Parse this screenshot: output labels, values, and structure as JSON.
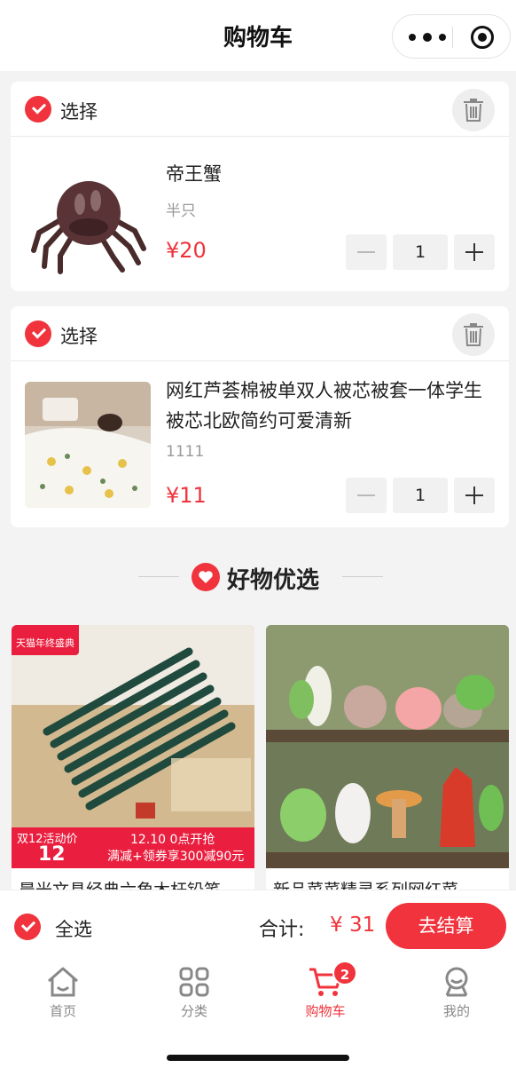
{
  "header": {
    "title": "购物车"
  },
  "cart": {
    "items": [
      {
        "select_label": "选择",
        "name": "帝王蟹",
        "spec": "半只",
        "price": "¥20",
        "qty": "1"
      },
      {
        "select_label": "选择",
        "name": "网红芦荟棉被单双人被芯被套一体学生被芯北欧简约可爱清新",
        "spec": "1111",
        "price": "¥11",
        "qty": "1"
      }
    ]
  },
  "recommend": {
    "title": "好物优选",
    "products": [
      {
        "name": "晨光文具经典六角木杆铅笔",
        "badge": "天猫年终盛典",
        "promo_tag": "双12活动价",
        "promo_price": "12",
        "promo_line1": "12.10 0点开抢",
        "promo_line2": "满减+领券享300减90元"
      },
      {
        "name": "新品菜菜精灵系列网红菜"
      }
    ]
  },
  "footer": {
    "select_all": "全选",
    "total_label": "合计:",
    "total_value": "¥ 31",
    "checkout": "去结算"
  },
  "tabbar": {
    "tabs": [
      {
        "label": "首页",
        "icon": "home-icon"
      },
      {
        "label": "分类",
        "icon": "grid-icon"
      },
      {
        "label": "购物车",
        "icon": "cart-icon",
        "badge": "2",
        "active": true
      },
      {
        "label": "我的",
        "icon": "user-icon"
      }
    ]
  },
  "colors": {
    "accent": "#f0333c",
    "background": "#f3f3f3"
  }
}
